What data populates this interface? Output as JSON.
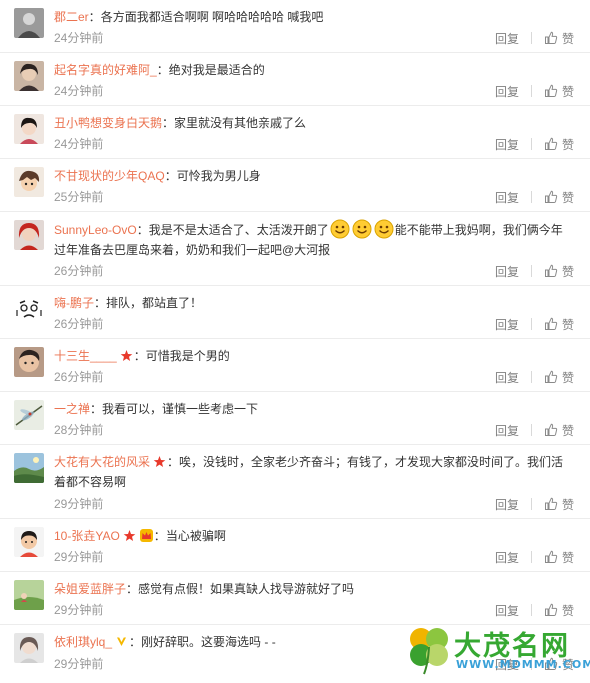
{
  "actions": {
    "reply_label": "回复",
    "like_label": "赞"
  },
  "comments": [
    {
      "user": "郡二er",
      "text": "各方面我都适合啊啊 啊哈哈哈哈哈    喊我吧",
      "time": "24分钟前",
      "avatar": "avatar-gray-person"
    },
    {
      "user": "起名字真的好难阿_",
      "text": "绝对我是最适合的",
      "time": "24分钟前",
      "avatar": "avatar-dark-hair"
    },
    {
      "user": "丑小鸭想变身白天鹅",
      "text": "家里就没有其他亲戚了么",
      "time": "24分钟前",
      "avatar": "avatar-girl"
    },
    {
      "user": "不甘现状的少年QAQ",
      "text": "可怜我为男儿身",
      "time": "25分钟前",
      "avatar": "avatar-cartoon"
    },
    {
      "user": "SunnyLeo-OvO",
      "text_before": "我是不是太适合了、太活泼开朗了",
      "text_after": "能不能带上我妈啊，我们俩今年过年准备去巴厘岛来着，奶奶和我们一起吧@大河报",
      "time": "26分钟前",
      "avatar": "avatar-red-hair"
    },
    {
      "user": "嗨-鹏子",
      "text": "排队，都站直了！",
      "time": "26分钟前",
      "avatar": "avatar-face-sketch"
    },
    {
      "user": "十三生____",
      "text": "可惜我是个男的",
      "time": "26分钟前",
      "avatar": "avatar-boy-face"
    },
    {
      "user": "一之禅",
      "text": "我看可以，谨慎一些考虑一下",
      "time": "28分钟前",
      "avatar": "avatar-dragonfly"
    },
    {
      "user": "大花有大花的风采",
      "text": "唉，没钱时，全家老少齐奋斗；有钱了，才发现大家都没时间了。我们活着都不容易啊",
      "time": "29分钟前",
      "avatar": "avatar-landscape"
    },
    {
      "user": "10-张垚YAO",
      "text": "当心被骗啊",
      "time": "29分钟前",
      "avatar": "avatar-kid"
    },
    {
      "user": "朵姐爱蓝胖子",
      "text": "感觉有点假！如果真缺人找导游就好了吗",
      "time": "29分钟前",
      "avatar": "avatar-green-field"
    },
    {
      "user": "依利琪ylq_",
      "text": "刚好辞职。这要海选吗 - -",
      "time": "29分钟前",
      "avatar": "avatar-light-portrait"
    }
  ],
  "watermark": {
    "name": "大茂名网",
    "url": "WWW.MDMMM.COM"
  },
  "colors": {
    "username": "#eb7350",
    "time": "#999999",
    "badge_red": "#e8392b",
    "vip_gold": "#f5b800"
  }
}
